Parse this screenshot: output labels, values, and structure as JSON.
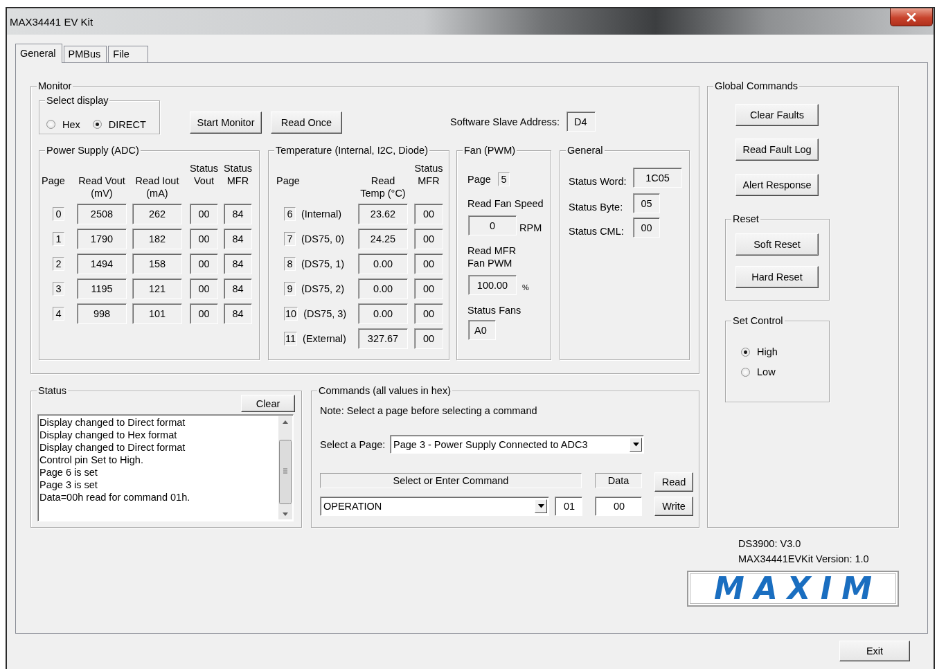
{
  "window": {
    "title": "MAX34441 EV Kit"
  },
  "tabs": [
    {
      "label": "General",
      "selected": true
    },
    {
      "label": "PMBus",
      "selected": false
    },
    {
      "label": "File",
      "selected": false
    }
  ],
  "monitor": {
    "title": "Monitor",
    "select_display": {
      "title": "Select display",
      "options": [
        {
          "label": "Hex",
          "selected": false
        },
        {
          "label": "DIRECT",
          "selected": true
        }
      ]
    },
    "buttons": [
      "Start Monitor",
      "Read Once"
    ],
    "slave_address": {
      "label": "Software Slave Address:",
      "value": "D4"
    },
    "power_supply": {
      "title": "Power Supply (ADC)",
      "columns": [
        "Page",
        "Read Vout (mV)",
        "Read Iout (mA)",
        "Status Vout",
        "Status MFR"
      ],
      "rows": [
        {
          "page": "0",
          "values": [
            "2508",
            "262",
            "00",
            "84"
          ]
        },
        {
          "page": "1",
          "values": [
            "1790",
            "182",
            "00",
            "84"
          ]
        },
        {
          "page": "2",
          "values": [
            "1494",
            "158",
            "00",
            "84"
          ]
        },
        {
          "page": "3",
          "values": [
            "1195",
            "121",
            "00",
            "84"
          ]
        },
        {
          "page": "4",
          "values": [
            "998",
            "101",
            "00",
            "84"
          ]
        }
      ]
    },
    "temperature": {
      "title": "Temperature (Internal, I2C, Diode)",
      "columns": [
        "Page",
        "Read Temp (°C)",
        "Status MFR"
      ],
      "rows": [
        {
          "page": "6",
          "sensor": "(Internal)",
          "values": [
            "23.62",
            "00"
          ]
        },
        {
          "page": "7",
          "sensor": "(DS75, 0)",
          "values": [
            "24.25",
            "00"
          ]
        },
        {
          "page": "8",
          "sensor": "(DS75, 1)",
          "values": [
            "0.00",
            "00"
          ]
        },
        {
          "page": "9",
          "sensor": "(DS75, 2)",
          "values": [
            "0.00",
            "00"
          ]
        },
        {
          "page": "10",
          "sensor": "(DS75, 3)",
          "values": [
            "0.00",
            "00"
          ]
        },
        {
          "page": "11",
          "sensor": "(External)",
          "values": [
            "327.67",
            "00"
          ]
        }
      ]
    },
    "fan": {
      "title": "Fan (PWM)",
      "page_label": "Page",
      "page": "5",
      "speed_label": "Read Fan Speed",
      "speed": "0",
      "speed_unit": "RPM",
      "pwm_label": "Read MFR Fan PWM",
      "pwm": "100.00",
      "pwm_unit": "%",
      "fans_label": "Status Fans",
      "fans": "A0"
    },
    "general": {
      "title": "General",
      "fields": [
        {
          "label": "Status Word:",
          "value": "1C05"
        },
        {
          "label": "Status Byte:",
          "value": "05"
        },
        {
          "label": "Status CML:",
          "value": "00"
        }
      ]
    }
  },
  "global_commands": {
    "title": "Global Commands",
    "buttons": [
      "Clear Faults",
      "Read Fault Log",
      "Alert Response"
    ],
    "reset": {
      "title": "Reset",
      "buttons": [
        "Soft Reset",
        "Hard Reset"
      ]
    },
    "set_control": {
      "title": "Set Control",
      "options": [
        {
          "label": "High",
          "selected": true
        },
        {
          "label": "Low",
          "selected": false
        }
      ]
    }
  },
  "status": {
    "title": "Status",
    "clear_button": "Clear",
    "log": [
      "Display changed to Direct format",
      "Display changed to Hex format",
      "Display changed to Direct format",
      "Control pin Set to High.",
      "Page 6 is set",
      "Page 3 is set",
      "Data=00h read for command 01h."
    ]
  },
  "commands": {
    "title": "Commands (all values in hex)",
    "note": "Note: Select a page before selecting a command",
    "page_label": "Select a Page:",
    "page_value": "Page 3 - Power Supply Connected to ADC3",
    "command_header": "Select or Enter Command",
    "data_header": "Data",
    "read_button": "Read",
    "command": "OPERATION",
    "code": "01",
    "data": "00",
    "write_button": "Write"
  },
  "version_lines": [
    "DS3900: V3.0",
    "MAX34441EVKit Version: 1.0"
  ],
  "logo": "MAXIM",
  "exit_button": "Exit"
}
